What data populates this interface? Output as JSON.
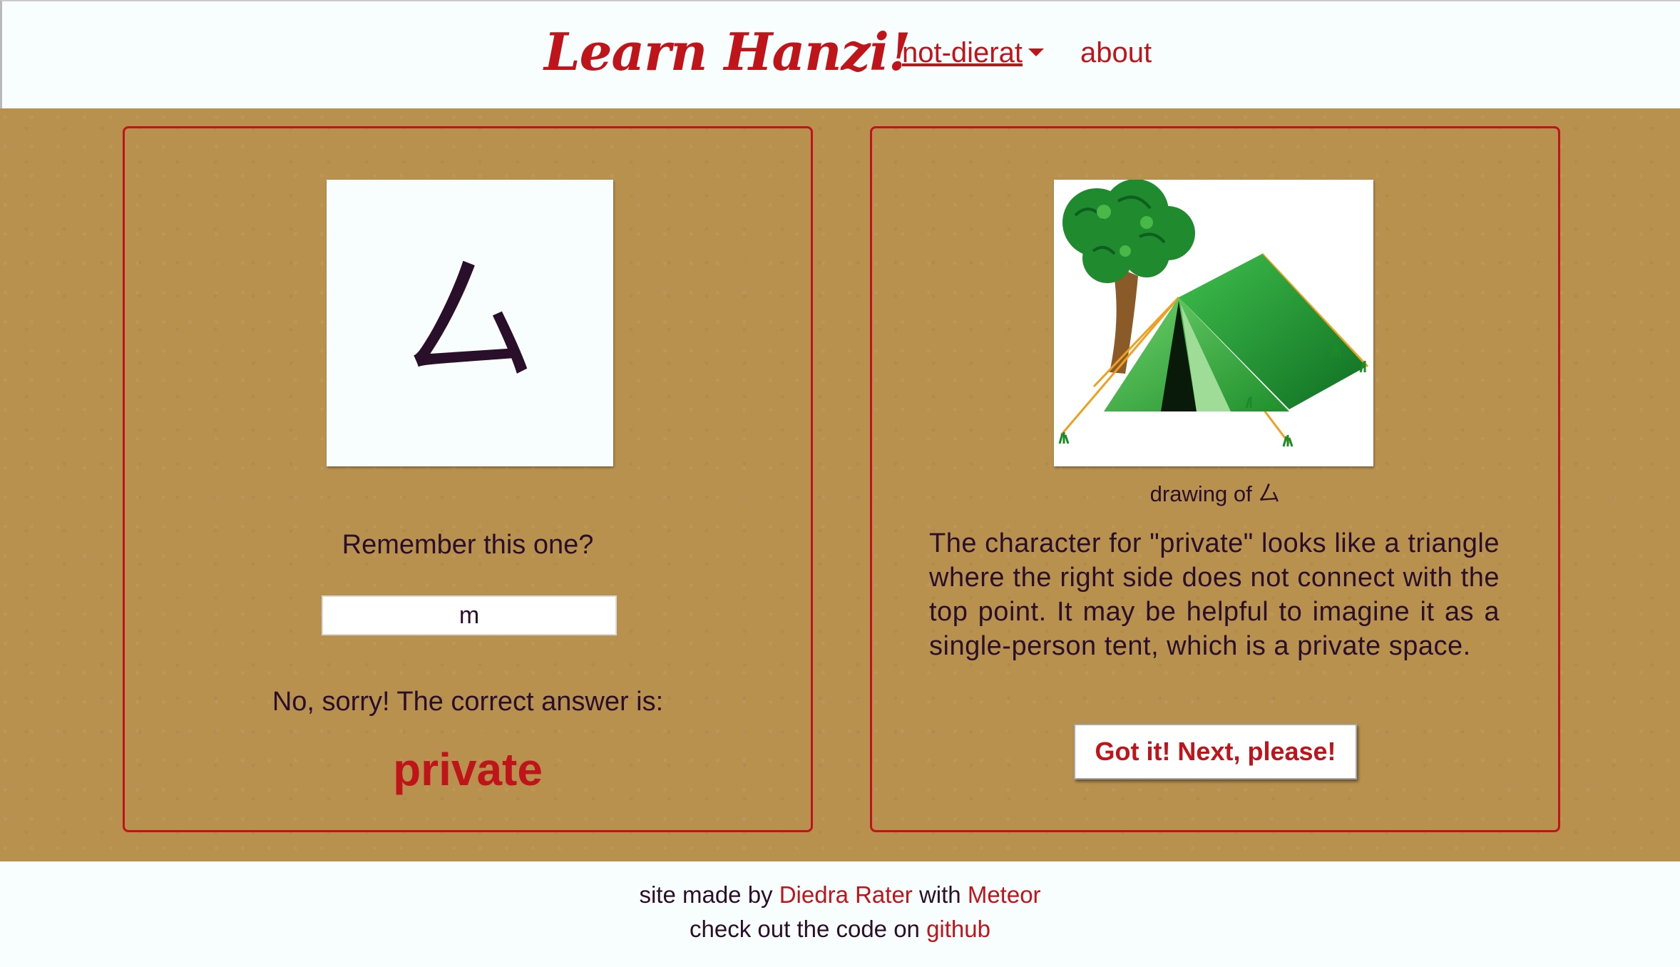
{
  "header": {
    "logo": "Learn Hanzi!",
    "user_menu": "not-dierat",
    "about_link": "about"
  },
  "quiz": {
    "character": "厶",
    "prompt": "Remember this one?",
    "answer_value": "m",
    "feedback": "No, sorry! The correct answer is:",
    "correct_answer": "private"
  },
  "mnemonic": {
    "caption": "drawing of 厶",
    "explanation": "The character for \"private\" looks like a triangle where the right side does not connect with the top point. It may be helpful to imagine it as a single-person tent, which is a private space.",
    "next_button": "Got it! Next, please!"
  },
  "footer": {
    "made_by_prefix": "site made by",
    "author": "Diedra Rater",
    "with_text": "with",
    "framework": "Meteor",
    "code_prefix": "check out the code on",
    "github": "github"
  },
  "colors": {
    "accent": "#c0141b",
    "background_band": "#b8914f",
    "text": "#2a0f2a",
    "tent_green": "#2eaa3c",
    "tree_green": "#1f8a2e"
  }
}
